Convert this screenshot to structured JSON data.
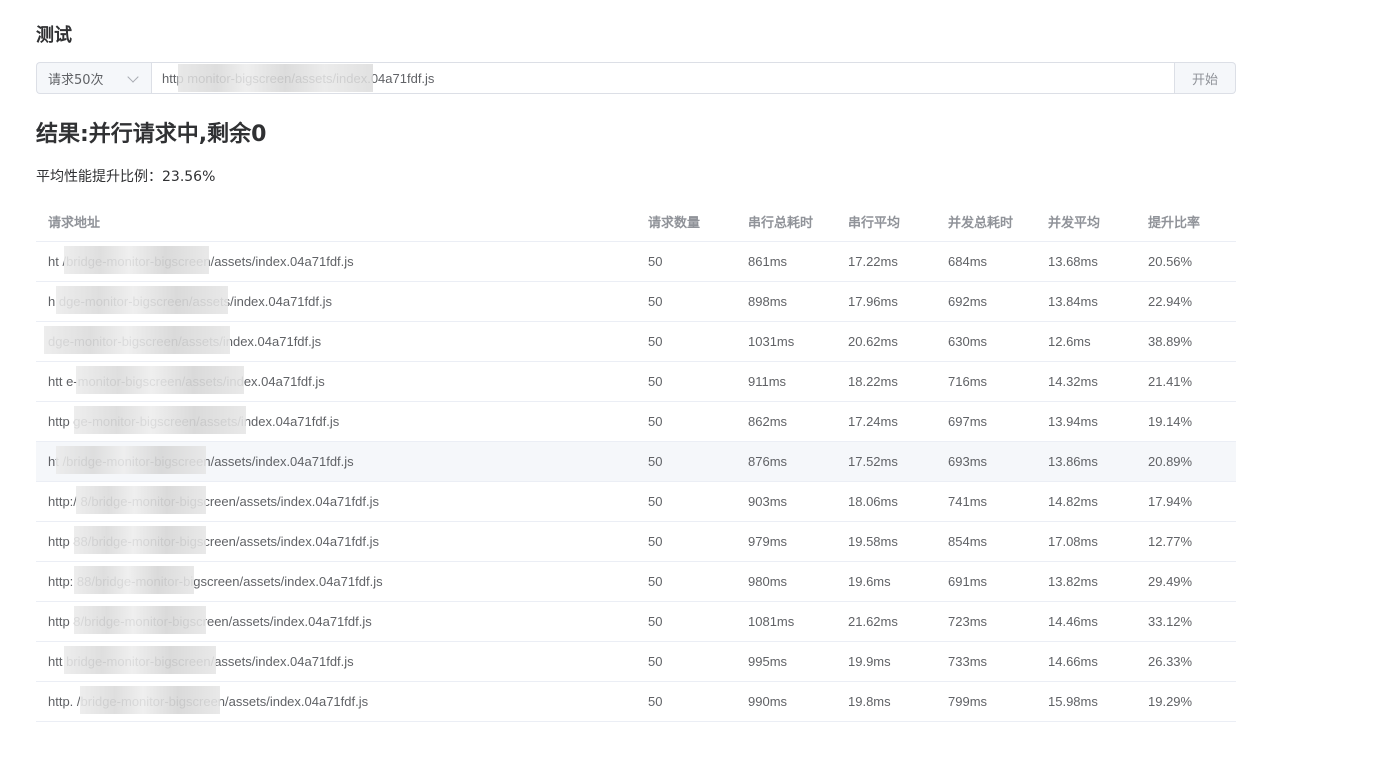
{
  "page": {
    "title": "测试"
  },
  "request_bar": {
    "select_value": "请求50次",
    "url_value": "http monitor-bigscreen/assets/index.04a71fdf.js",
    "start_label": "开始"
  },
  "result": {
    "title": "结果:并行请求中,剩余0",
    "avg_text": "平均性能提升比例：23.56%"
  },
  "table": {
    "headers": [
      "请求地址",
      "请求数量",
      "串行总耗时",
      "串行平均",
      "并发总耗时",
      "并发平均",
      "提升比率"
    ],
    "rows": [
      {
        "url": "ht /bridge-monitor-bigscreen/assets/index.04a71fdf.js",
        "count": "50",
        "serial_total": "861ms",
        "serial_avg": "17.22ms",
        "parallel_total": "684ms",
        "parallel_avg": "13.68ms",
        "ratio": "20.56%"
      },
      {
        "url": "h dge-monitor-bigscreen/assets/index.04a71fdf.js",
        "count": "50",
        "serial_total": "898ms",
        "serial_avg": "17.96ms",
        "parallel_total": "692ms",
        "parallel_avg": "13.84ms",
        "ratio": "22.94%"
      },
      {
        "url": "dge-monitor-bigscreen/assets/index.04a71fdf.js",
        "count": "50",
        "serial_total": "1031ms",
        "serial_avg": "20.62ms",
        "parallel_total": "630ms",
        "parallel_avg": "12.6ms",
        "ratio": "38.89%"
      },
      {
        "url": "htt e-monitor-bigscreen/assets/index.04a71fdf.js",
        "count": "50",
        "serial_total": "911ms",
        "serial_avg": "18.22ms",
        "parallel_total": "716ms",
        "parallel_avg": "14.32ms",
        "ratio": "21.41%"
      },
      {
        "url": "http ge-monitor-bigscreen/assets/index.04a71fdf.js",
        "count": "50",
        "serial_total": "862ms",
        "serial_avg": "17.24ms",
        "parallel_total": "697ms",
        "parallel_avg": "13.94ms",
        "ratio": "19.14%"
      },
      {
        "url": "ht /bridge-monitor-bigscreen/assets/index.04a71fdf.js",
        "count": "50",
        "serial_total": "876ms",
        "serial_avg": "17.52ms",
        "parallel_total": "693ms",
        "parallel_avg": "13.86ms",
        "ratio": "20.89%"
      },
      {
        "url": "http:/ 8/bridge-monitor-bigscreen/assets/index.04a71fdf.js",
        "count": "50",
        "serial_total": "903ms",
        "serial_avg": "18.06ms",
        "parallel_total": "741ms",
        "parallel_avg": "14.82ms",
        "ratio": "17.94%"
      },
      {
        "url": "http 88/bridge-monitor-bigscreen/assets/index.04a71fdf.js",
        "count": "50",
        "serial_total": "979ms",
        "serial_avg": "19.58ms",
        "parallel_total": "854ms",
        "parallel_avg": "17.08ms",
        "ratio": "12.77%"
      },
      {
        "url": "http: 88/bridge-monitor-bigscreen/assets/index.04a71fdf.js",
        "count": "50",
        "serial_total": "980ms",
        "serial_avg": "19.6ms",
        "parallel_total": "691ms",
        "parallel_avg": "13.82ms",
        "ratio": "29.49%"
      },
      {
        "url": "http 8/bridge-monitor-bigscreen/assets/index.04a71fdf.js",
        "count": "50",
        "serial_total": "1081ms",
        "serial_avg": "21.62ms",
        "parallel_total": "723ms",
        "parallel_avg": "14.46ms",
        "ratio": "33.12%"
      },
      {
        "url": "htt bridge-monitor-bigscreen/assets/index.04a71fdf.js",
        "count": "50",
        "serial_total": "995ms",
        "serial_avg": "19.9ms",
        "parallel_total": "733ms",
        "parallel_avg": "14.66ms",
        "ratio": "26.33%"
      },
      {
        "url": "http. /bridge-monitor-bigscreen/assets/index.04a71fdf.js",
        "count": "50",
        "serial_total": "990ms",
        "serial_avg": "19.8ms",
        "parallel_total": "799ms",
        "parallel_avg": "15.98ms",
        "ratio": "19.29%"
      }
    ]
  }
}
